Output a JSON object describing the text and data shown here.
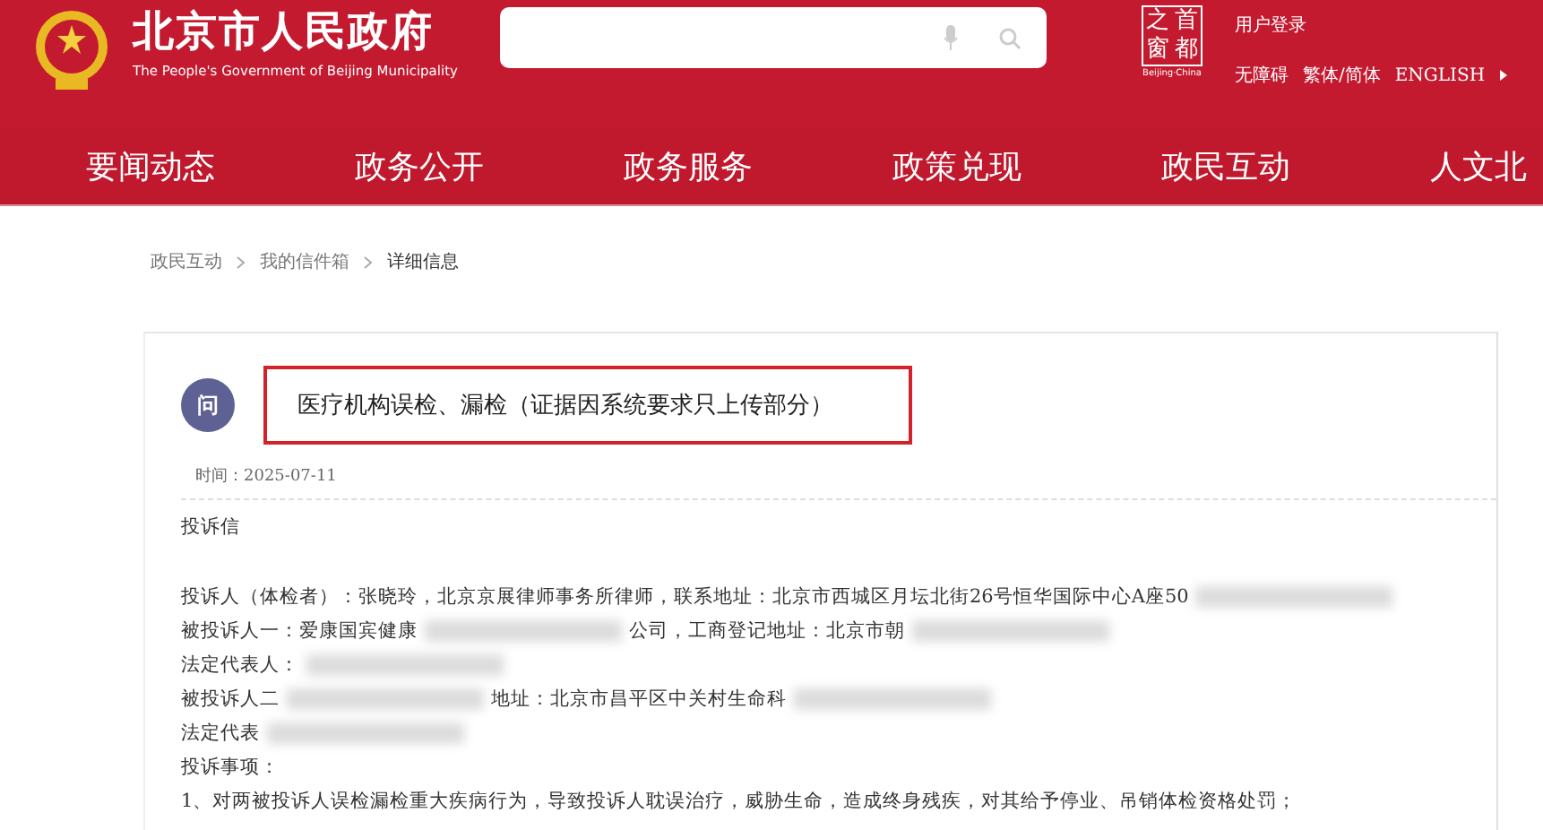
{
  "header": {
    "title": "北京市人民政府",
    "subtitle": "The People's Government of Beijing Municipality",
    "logo_cells": [
      "之",
      "首",
      "窗",
      "都"
    ],
    "logo_caption": "Beijing·China",
    "user_login": "用户登录",
    "links": [
      "无障碍",
      "繁体/简体",
      "ENGLISH"
    ]
  },
  "nav": [
    "要闻动态",
    "政务公开",
    "政务服务",
    "政策兑现",
    "政民互动",
    "人文北"
  ],
  "breadcrumb": [
    "政民互动",
    "我的信件箱",
    "详细信息"
  ],
  "letter": {
    "badge": "问",
    "title": "医疗机构误检、漏检（证据因系统要求只上传部分）",
    "time_label": "时间：",
    "time": "2025-07-11",
    "heading": "投诉信",
    "lines": [
      {
        "segments": [
          {
            "kind": "text",
            "text": "投诉人（体检者）：张晓玲，北京京展律师事务所律师，联系地址：北京市西城区月坛北街26号恒华国际中心A座50"
          },
          {
            "kind": "redacted"
          }
        ]
      },
      {
        "segments": [
          {
            "kind": "text",
            "text": "被投诉人一：爱康国宾健康"
          },
          {
            "kind": "redacted"
          },
          {
            "kind": "text",
            "text": "公司，工商登记地址：北京市朝"
          },
          {
            "kind": "redacted"
          }
        ]
      },
      {
        "segments": [
          {
            "kind": "text",
            "text": "法定代表人："
          },
          {
            "kind": "redacted"
          }
        ]
      },
      {
        "segments": [
          {
            "kind": "text",
            "text": "被投诉人二"
          },
          {
            "kind": "redacted"
          },
          {
            "kind": "text",
            "text": "地址：北京市昌平区中关村生命科"
          },
          {
            "kind": "redacted"
          }
        ]
      },
      {
        "segments": [
          {
            "kind": "text",
            "text": "法定代表"
          },
          {
            "kind": "redacted"
          }
        ]
      },
      {
        "segments": [
          {
            "kind": "text",
            "text": "投诉事项："
          }
        ]
      },
      {
        "segments": [
          {
            "kind": "text",
            "text": "1、对两被投诉人误检漏检重大疾病行为，导致投诉人耽误治疗，威胁生命，造成终身残疾，对其给予停业、吊销体检资格处罚；"
          }
        ]
      }
    ]
  }
}
